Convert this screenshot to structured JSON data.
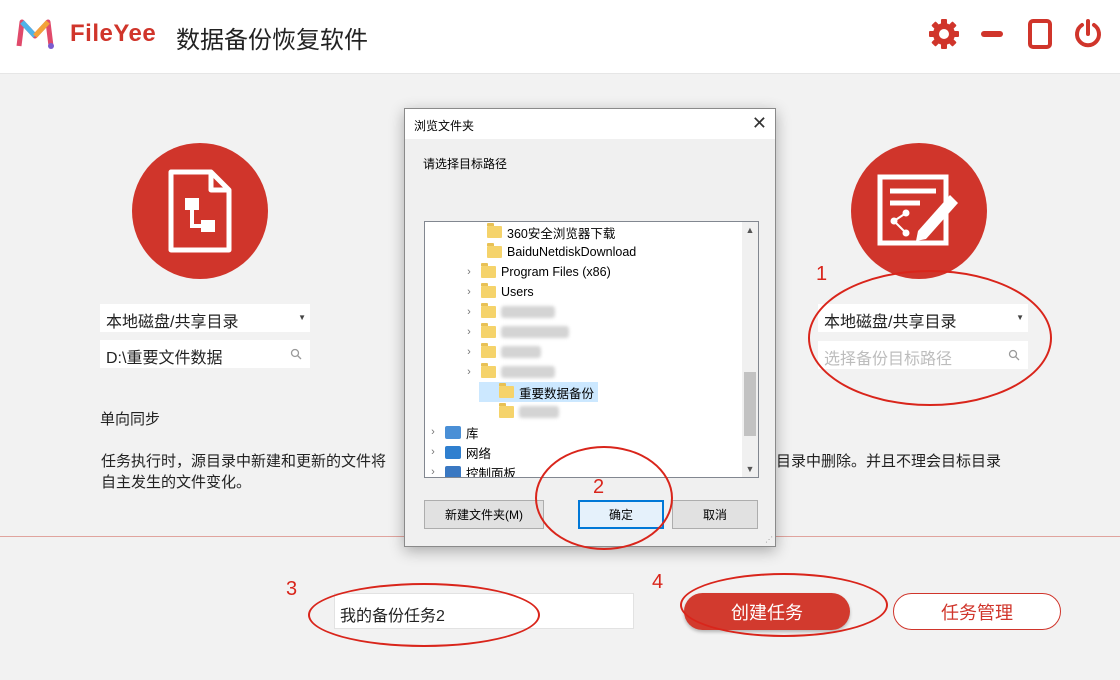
{
  "header": {
    "brand": "FileYee",
    "app_title": "数据备份恢复软件",
    "buttons": [
      "gear-icon",
      "minimize-icon",
      "maximize-icon",
      "power-icon"
    ]
  },
  "source": {
    "type_select": "本地磁盘/共享目录",
    "path_value": "D:\\重要文件数据"
  },
  "target": {
    "type_select": "本地磁盘/共享目录",
    "path_placeholder": "选择备份目标路径"
  },
  "mode": {
    "title": "单向同步",
    "desc_line1_left": "任务执行时，源目录中新建和更新的文件将",
    "desc_line1_right": "目录中删除。并且不理会目标目录",
    "desc_line2": "自主发生的文件变化。"
  },
  "footer": {
    "task_name_value": "我的备份任务2",
    "create_label": "创建任务",
    "manage_label": "任务管理"
  },
  "dialog": {
    "title": "浏览文件夹",
    "close": "✕",
    "prompt": "请选择目标路径",
    "tree": [
      {
        "label": "360安全浏览器下载",
        "chevron": ""
      },
      {
        "label": "BaiduNetdiskDownload",
        "chevron": ""
      },
      {
        "label": "Program Files (x86)",
        "chevron": "›"
      },
      {
        "label": "Users",
        "chevron": "›"
      },
      {
        "label": "",
        "chevron": "›",
        "blurred": true
      },
      {
        "label": "",
        "chevron": "›",
        "blurred": true
      },
      {
        "label": "",
        "chevron": "›",
        "blurred": true
      },
      {
        "label": "",
        "chevron": "›",
        "blurred": true
      },
      {
        "label": "重要数据备份",
        "chevron": "",
        "selected": true
      },
      {
        "label": "",
        "chevron": "",
        "blurred": true
      },
      {
        "label": "库",
        "chevron": "›",
        "root": true
      },
      {
        "label": "网络",
        "chevron": "›",
        "root": true
      },
      {
        "label": "控制面板",
        "chevron": "›",
        "root": true
      }
    ],
    "new_folder_label": "新建文件夹(M)",
    "ok_label": "确定",
    "cancel_label": "取消"
  },
  "annotations": [
    "1",
    "2",
    "3",
    "4"
  ],
  "colors": {
    "brand_red": "#d0352b",
    "annotation_red": "#d9251b",
    "selection_blue": "#cce8ff"
  }
}
